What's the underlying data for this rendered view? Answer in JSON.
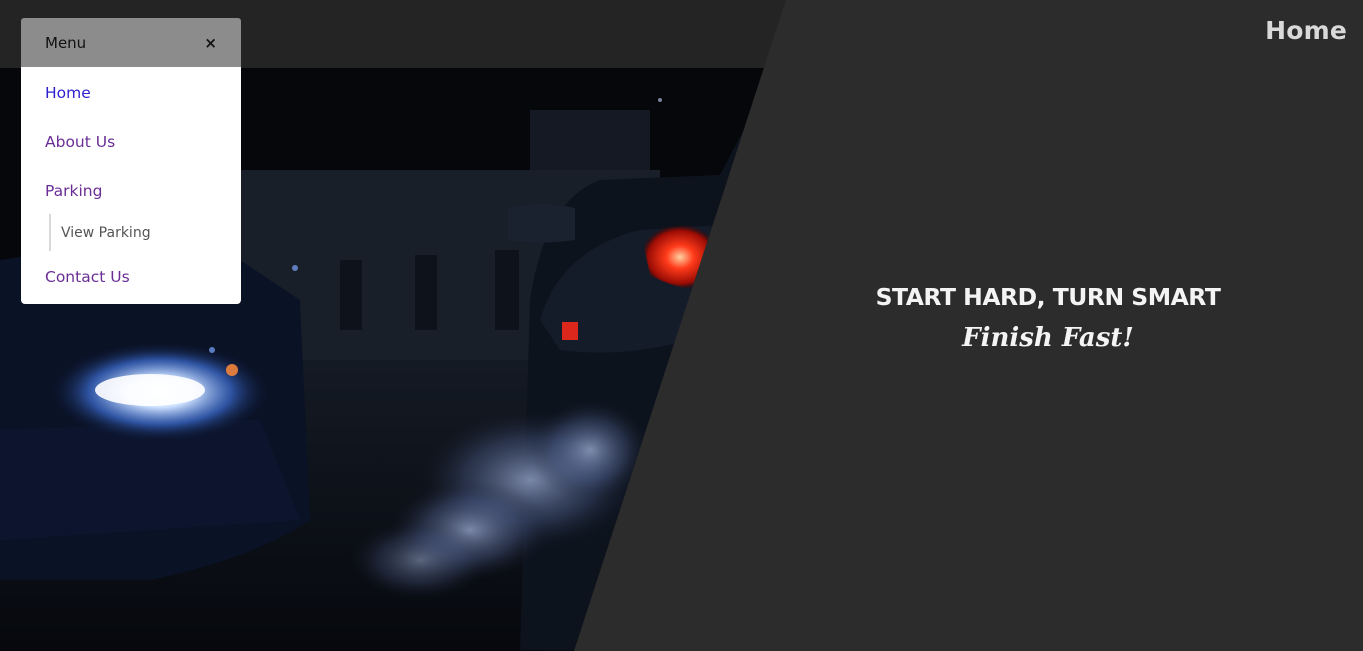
{
  "header": {
    "page_title": "Home"
  },
  "menu": {
    "label": "Menu",
    "close_symbol": "×",
    "items": [
      {
        "label": "Home"
      },
      {
        "label": "About Us"
      },
      {
        "label": "Parking"
      },
      {
        "label": "Contact Us"
      }
    ],
    "parking_submenu": [
      {
        "label": "View Parking"
      }
    ]
  },
  "hero": {
    "headline": "START HARD, TURN SMART",
    "subheadline": "Finish Fast!",
    "image_subject": "two cars at night with headlights, taillights and exhaust smoke"
  },
  "colors": {
    "active_link": "#2d1fd0",
    "link": "#6a2d96",
    "panel_background": "#2c2c2c",
    "menu_header": "#8c8c8c"
  }
}
